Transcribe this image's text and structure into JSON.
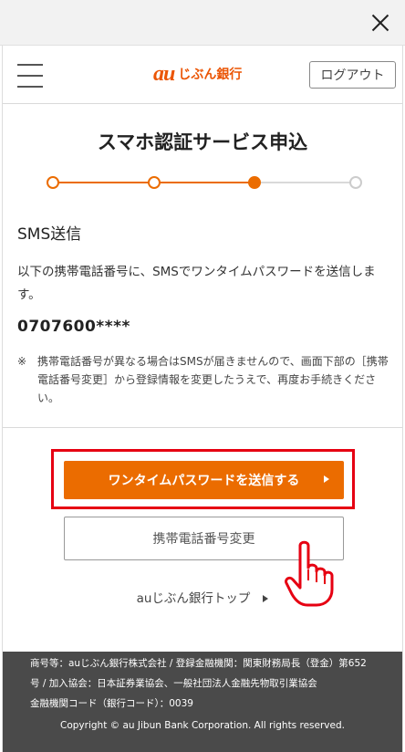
{
  "window": {
    "close_icon": "close-icon"
  },
  "header": {
    "logo_mark": "au",
    "logo_text": "じぶん銀行",
    "logout_label": "ログアウト",
    "menu_icon": "hamburger-menu-icon"
  },
  "page": {
    "title": "スマホ認証サービス申込",
    "stepper": {
      "total_steps": 4,
      "current_step": 3
    },
    "section_title": "SMS送信",
    "description": "以下の携帯電話番号に、SMSでワンタイムパスワードを送信します。",
    "phone_number": "0707600****",
    "note_mark": "※",
    "note_text": "携帯電話番号が異なる場合はSMSが届きませんので、画面下部の［携帯電話番号変更］から登録情報を変更したうえで、再度お手続きください。",
    "send_button_label": "ワンタイムパスワードを送信する",
    "change_phone_button_label": "携帯電話番号変更",
    "top_link_label": "auじぶん銀行トップ"
  },
  "footer": {
    "line1": "商号等：auじぶん銀行株式会社 / 登録金融機関：関東財務局長（登金）第652",
    "line2": "号 / 加入協会：日本証券業協会、一般社団法人金融先物取引業協会",
    "line3": "金融機関コード（銀行コード）：0039",
    "copyright": "Copyright © au Jibun Bank Corporation. All rights reserved."
  },
  "colors": {
    "brand_orange": "#eb6c00",
    "highlight_red": "#e60012",
    "footer_bg": "#4a4a4a"
  }
}
